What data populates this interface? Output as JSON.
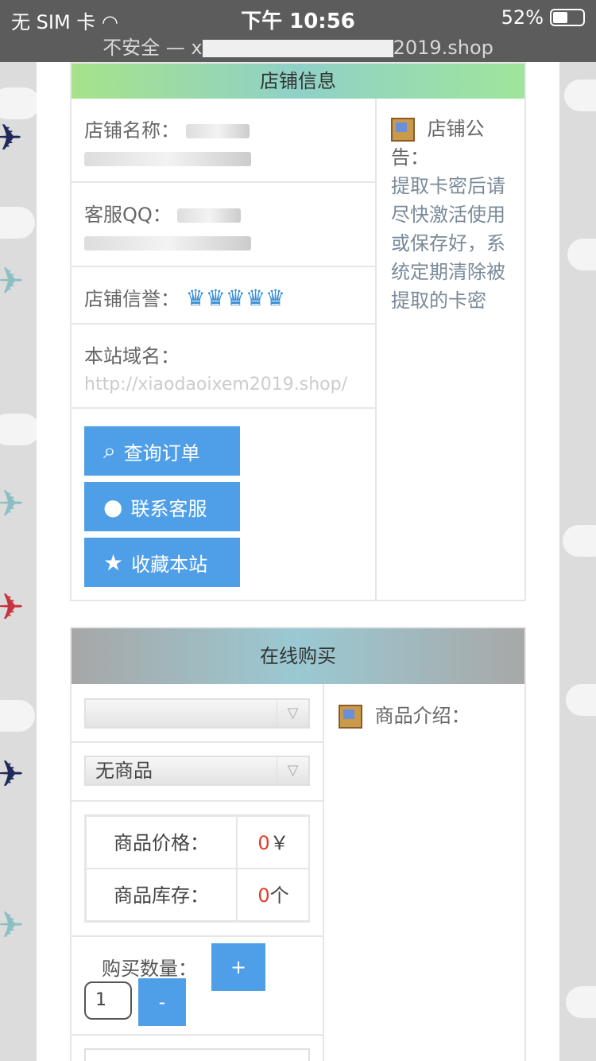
{
  "status_bar": {
    "carrier": "无 SIM 卡",
    "time": "下午 10:56",
    "battery": "52%",
    "url_prefix": "不安全 — x",
    "url_suffix": "2019.shop"
  },
  "shop_info": {
    "title": "店铺信息",
    "shop_name_label": "店铺名称：",
    "service_qq_label": "客服QQ：",
    "reputation_label": "店铺信誉：",
    "reputation_icons": "♛♛♛♛♛",
    "domain_label": "本站域名：",
    "domain_value": "http://xiaodaoixem2019.shop/",
    "notice_label": "店铺公告：",
    "notice_text": "提取卡密后请尽快激活使用或保存好，系统定期清除被提取的卡密",
    "buttons": [
      {
        "label": "查询订单",
        "icon": "search-icon"
      },
      {
        "label": "联系客服",
        "icon": "qq-icon"
      },
      {
        "label": "收藏本站",
        "icon": "star-icon"
      }
    ]
  },
  "online_buy": {
    "title": "在线购买",
    "category_select": "",
    "product_select": "无商品",
    "price_label": "商品价格：",
    "price_value": "0",
    "price_unit": "￥",
    "stock_label": "商品库存：",
    "stock_value": "0",
    "stock_unit": "个",
    "quantity_label": "购买数量：",
    "quantity_value": "1",
    "plus": "+",
    "minus": "-",
    "intro_label": "商品介绍："
  }
}
